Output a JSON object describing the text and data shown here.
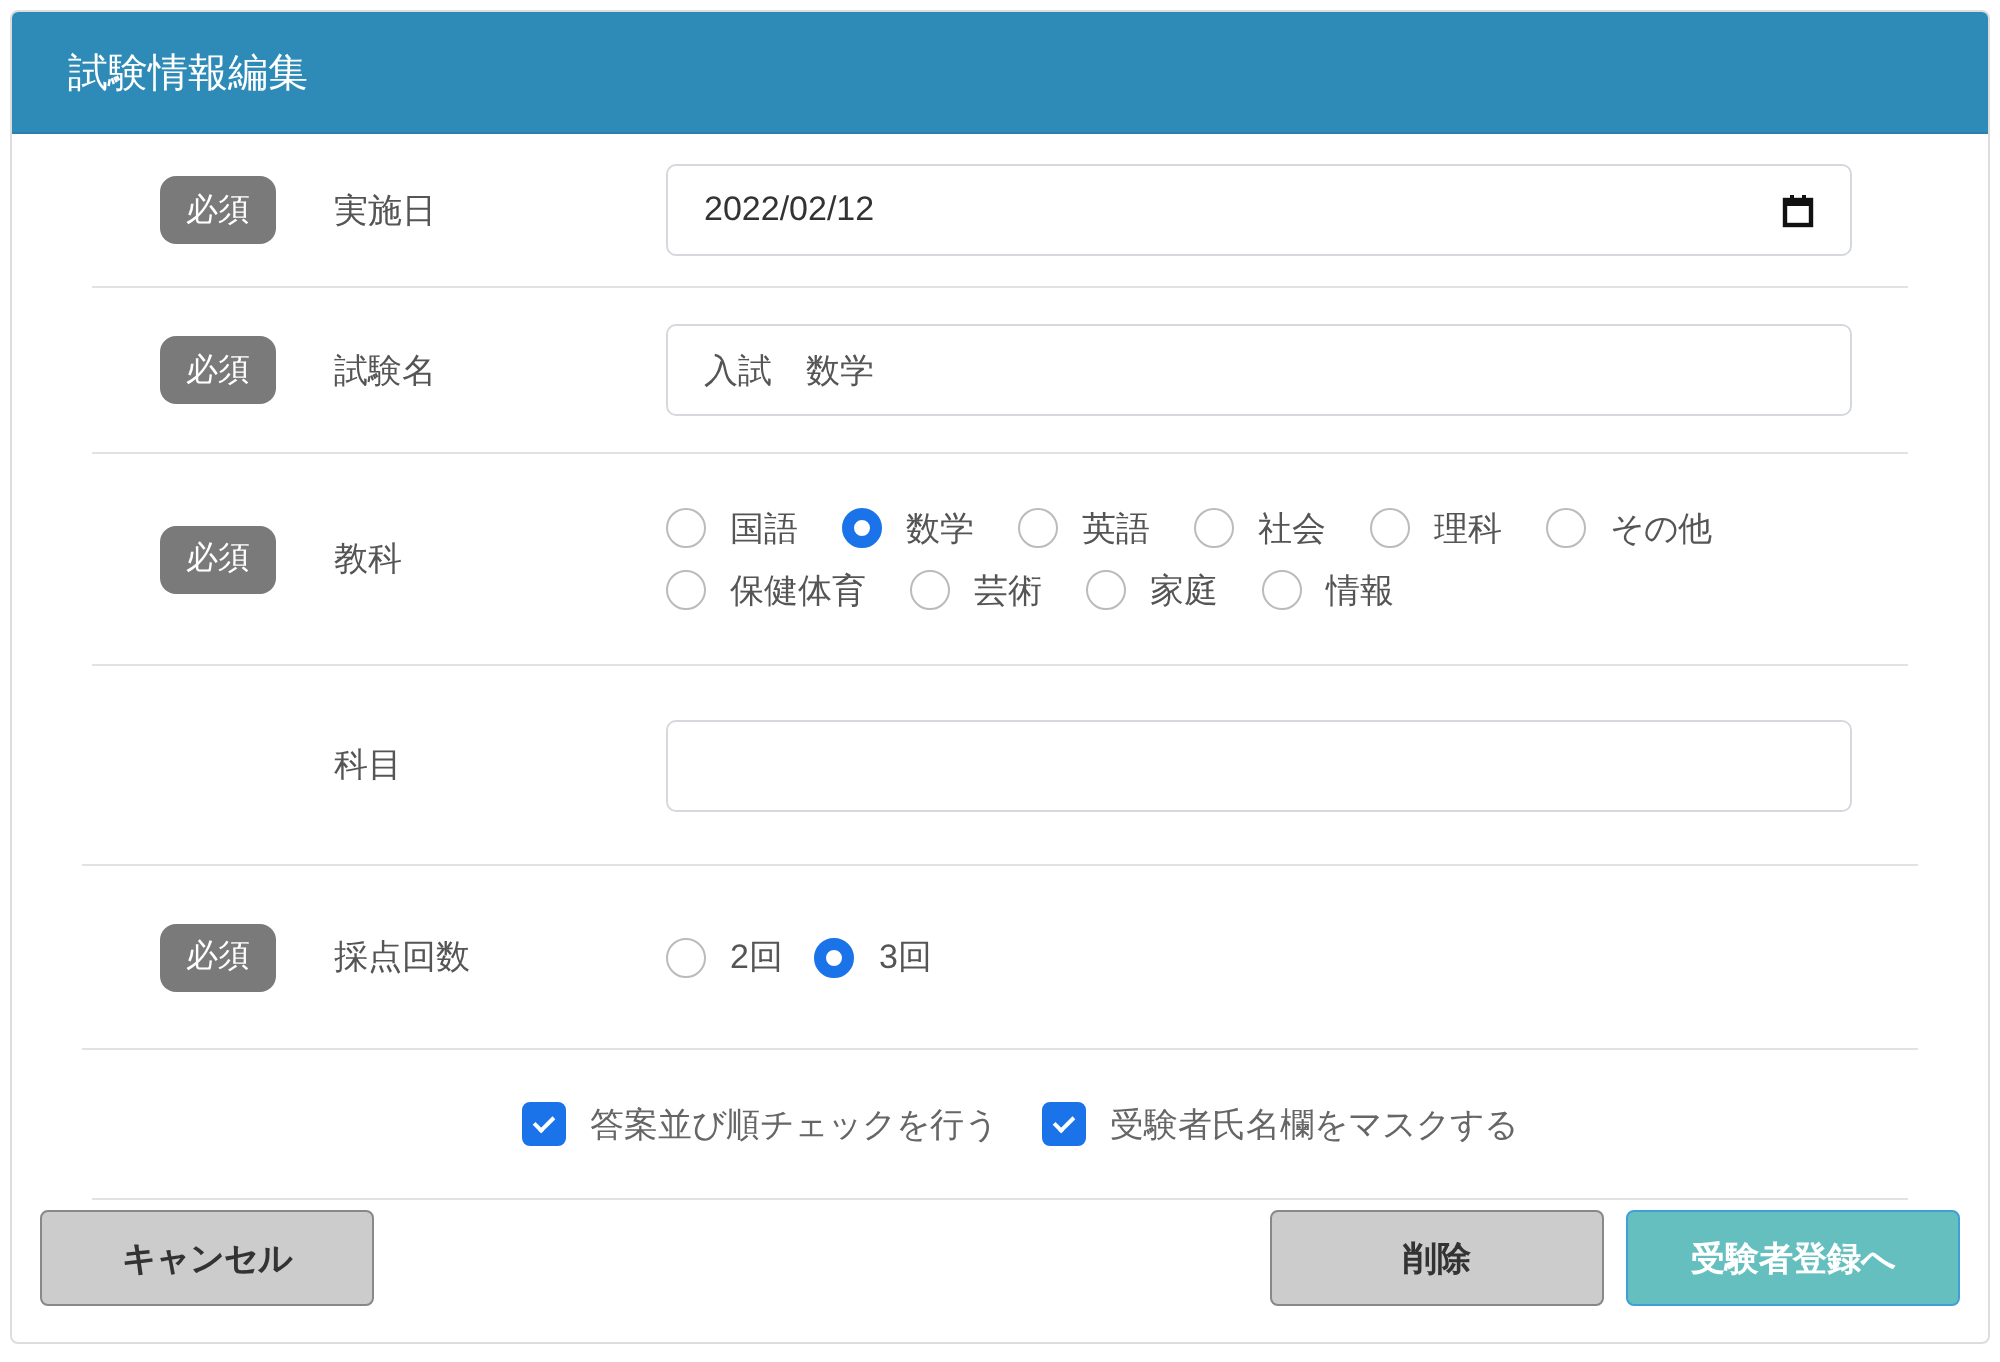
{
  "header": {
    "title": "試験情報編集"
  },
  "fields": [
    {
      "kind": "date",
      "badge": "必須",
      "label": "実施日",
      "value": "2022/02/12"
    },
    {
      "kind": "text",
      "badge": "必須",
      "label": "試験名",
      "value": "入試　数学"
    },
    {
      "kind": "radio",
      "badge": "必須",
      "label": "教科",
      "options": [
        {
          "label": "国語",
          "selected": false
        },
        {
          "label": "数学",
          "selected": true
        },
        {
          "label": "英語",
          "selected": false
        },
        {
          "label": "社会",
          "selected": false
        },
        {
          "label": "理科",
          "selected": false
        },
        {
          "label": "その他",
          "selected": false
        },
        {
          "label": "保健体育",
          "selected": false
        },
        {
          "label": "芸術",
          "selected": false
        },
        {
          "label": "家庭",
          "selected": false
        },
        {
          "label": "情報",
          "selected": false
        }
      ]
    },
    {
      "kind": "text",
      "label": "科目"
    },
    {
      "kind": "radio",
      "badge": "必須",
      "label": "採点回数",
      "options": [
        {
          "label": "2回",
          "selected": false
        },
        {
          "label": "3回",
          "selected": true
        }
      ]
    }
  ],
  "checkboxes": [
    {
      "label": "答案並び順チェックを行う",
      "checked": true
    },
    {
      "label": "受験者氏名欄をマスクする",
      "checked": true
    }
  ],
  "buttons": [
    {
      "label": "キャンセル",
      "kind": "secondary"
    },
    {
      "label": "削除",
      "kind": "secondary"
    },
    {
      "label": "受験者登録へ",
      "kind": "primary"
    }
  ]
}
